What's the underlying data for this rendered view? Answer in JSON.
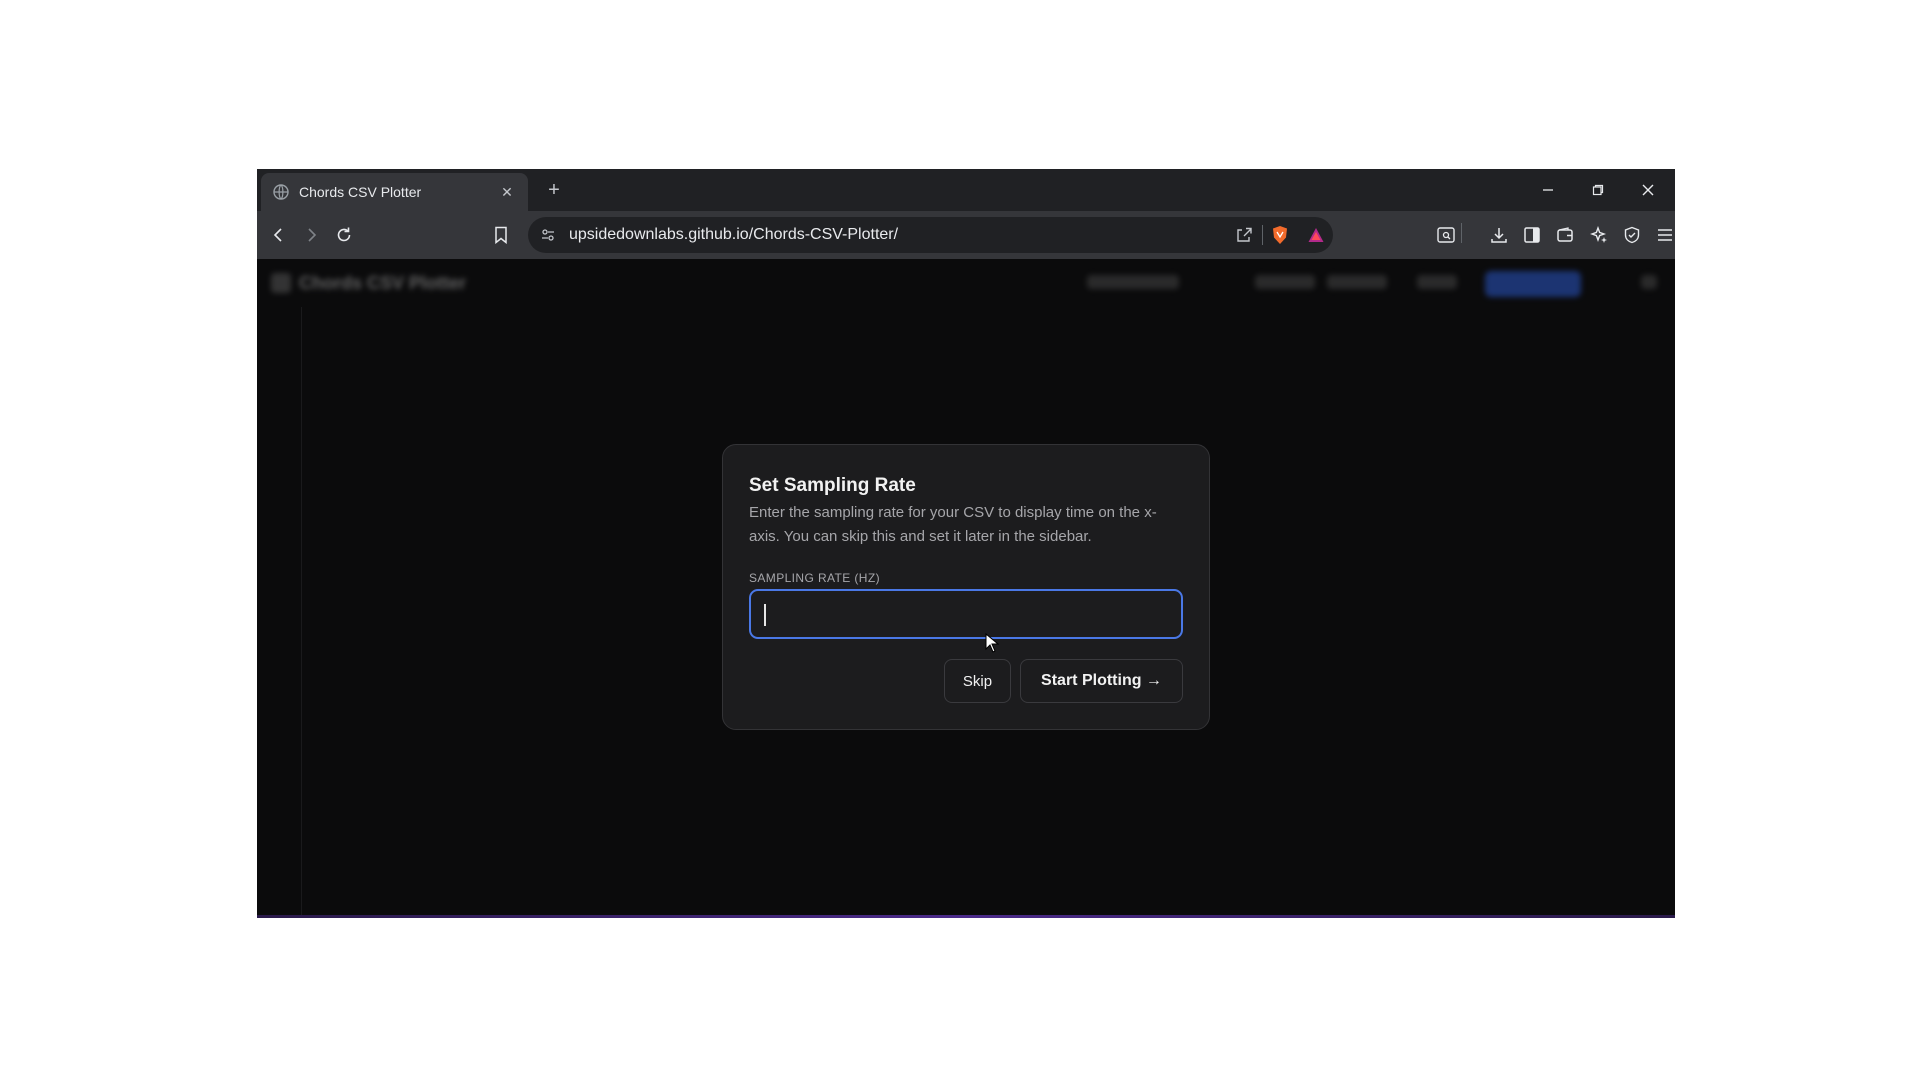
{
  "browser": {
    "tab": {
      "title": "Chords CSV Plotter"
    },
    "address_bar": {
      "url": "upsidedownlabs.github.io/Chords-CSV-Plotter/"
    }
  },
  "page": {
    "app_title": "Chords CSV Plotter"
  },
  "modal": {
    "title": "Set Sampling Rate",
    "description": "Enter the sampling rate for your CSV to display time on the x-axis. You can skip this and set it later in the sidebar.",
    "field_label": "SAMPLING RATE (HZ)",
    "field_value": "",
    "skip_label": "Skip",
    "start_label": "Start Plotting →"
  },
  "colors": {
    "accent": "#4a78e6",
    "modal_bg": "#1c1c1e",
    "page_bg": "#0b0b0c"
  }
}
